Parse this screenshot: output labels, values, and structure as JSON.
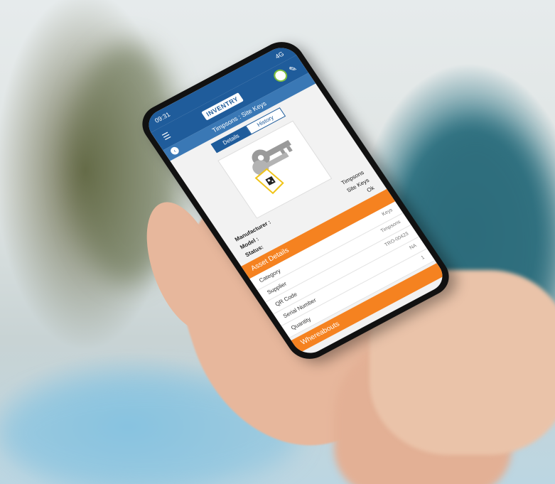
{
  "status_bar": {
    "time": "09:31",
    "network": "4G"
  },
  "app": {
    "logo": "INVENTRY"
  },
  "screen_title": "Timpsons : Site Keys",
  "tabs": [
    {
      "label": "Details",
      "active": true
    },
    {
      "label": "History",
      "active": false
    }
  ],
  "asset_info": [
    {
      "key": "Manufacturer :",
      "value": "Timpsons"
    },
    {
      "key": "Model :",
      "value": "Site Keys"
    },
    {
      "key": "Status:",
      "value": "Ok"
    }
  ],
  "asset_details": {
    "heading": "Asset Details",
    "rows": [
      {
        "key": "Category",
        "value": "Keys"
      },
      {
        "key": "Supplier",
        "value": "Timpsons"
      },
      {
        "key": "QR Code",
        "value": "TRO-00423"
      },
      {
        "key": "Serial Number",
        "value": "NA"
      },
      {
        "key": "Quantity",
        "value": "1"
      }
    ]
  },
  "whereabouts": {
    "heading": "Whereabouts"
  },
  "colors": {
    "brand_blue": "#1f5c9b",
    "accent_orange": "#f58220"
  },
  "icons": {
    "menu": "hamburger-icon",
    "edit": "pencil-icon",
    "back": "back-arrow-icon"
  }
}
